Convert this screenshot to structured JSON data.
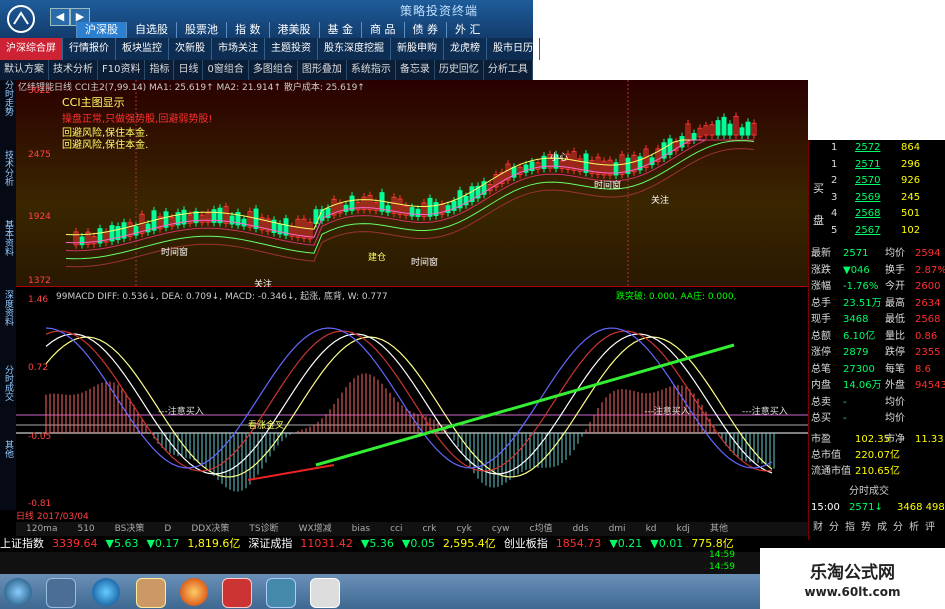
{
  "window": {
    "title": "策略投资终端",
    "title_menu": [
      "沪深股",
      "自选股",
      "股票池",
      "指 数",
      "港美股",
      "基 金",
      "商 品",
      "债 券",
      "外 汇"
    ],
    "title_menu_active": "沪深股"
  },
  "nav_tabs": [
    "沪深综合屏",
    "行情报价",
    "板块监控",
    "次新股",
    "市场关注",
    "主题投资",
    "股东深度挖掘",
    "新股申购",
    "龙虎榜",
    "股市日历"
  ],
  "toolbar": [
    "默认方案",
    "技术分析",
    "F10资料",
    "指标",
    "日线",
    "0窗组合",
    "多图组合",
    "图形叠加",
    "系统指示",
    "备忘录",
    "历史回忆",
    "分析工具"
  ],
  "left_tabs": [
    "分时走势",
    "技术分析",
    "基本资料",
    "深度资料",
    "分时成交",
    "其他"
  ],
  "pane1": {
    "header": "亿纬锂能日线 CCI主2(7,99.14) MA1: 25.619↑ MA2: 21.914↑ 散户成本: 25.619↑",
    "cci_title": "CCI主图显示",
    "lines": [
      "操盘正常,只做强势股,回避弱势股!",
      "回避风险,保住本金.",
      "回避风险,保住本金."
    ],
    "y_labels": [
      "3022",
      "2475",
      "1924",
      "1372"
    ],
    "annotations": [
      "时间窗",
      "建仓",
      "关注",
      "时间窗",
      "时间窗",
      "关注",
      "小心"
    ]
  },
  "pane2": {
    "header": "99MACD DIFF: 0.536↓, DEA: 0.709↓, MACD: -0.346↓, 起涨, 底背, W: 0.777",
    "right_header": "跌突破: 0.000, AA庄: 0.000,",
    "y_labels": [
      "1.46",
      "0.72",
      "-0.05",
      "-0.81"
    ],
    "labels": [
      "---注意买入",
      "---注意买入",
      "---注意买入",
      "看涨金叉"
    ],
    "bottom_left": "日线 2017/03/04"
  },
  "index_bar": [
    "120ma",
    "510",
    "BS决策",
    "D",
    "DDX决策",
    "TS诊断",
    "WX增减",
    "bias",
    "cci",
    "crk",
    "cyk",
    "cyw",
    "c均值",
    "dds",
    "dmi",
    "kd",
    "kdj",
    "其他"
  ],
  "ticker": {
    "items": [
      {
        "name": "上证指数",
        "value": "3339.64",
        "chg": "▼5.63",
        "pct": "▼0.17",
        "amt": "1,819.6亿"
      },
      {
        "name": "深证成指",
        "value": "11031.42",
        "chg": "▼5.36",
        "pct": "▼0.05",
        "amt": "2,595.4亿"
      },
      {
        "name": "创业板指",
        "value": "1854.73",
        "chg": "▼0.21",
        "pct": "▼0.01",
        "amt": "775.8亿"
      }
    ]
  },
  "right_panel": {
    "order_book": [
      {
        "lvl": "1",
        "price": "2572",
        "vol": "864"
      },
      {
        "lvl": "1",
        "price": "2571",
        "vol": "296"
      },
      {
        "lvl": "2",
        "price": "2570",
        "vol": "926"
      },
      {
        "lvl": "3",
        "price": "2569",
        "vol": "245"
      },
      {
        "lvl": "4",
        "price": "2568",
        "vol": "501"
      },
      {
        "lvl": "5",
        "price": "2567",
        "vol": "102"
      }
    ],
    "side_buy": "买",
    "side_sell": "盘",
    "stats": [
      [
        "最新",
        "2571",
        "均价",
        "2594"
      ],
      [
        "涨跌",
        "▼046",
        "换手",
        "2.87%"
      ],
      [
        "涨幅",
        "-1.76%",
        "今开",
        "2600"
      ],
      [
        "总手",
        "23.51万",
        "最高",
        "2634"
      ],
      [
        "现手",
        "3468",
        "最低",
        "2568"
      ],
      [
        "总额",
        "6.10亿",
        "量比",
        "0.86"
      ],
      [
        "涨停",
        "2879",
        "跌停",
        "2355"
      ],
      [
        "总笔",
        "27300",
        "每笔",
        "8.6"
      ],
      [
        "内盘",
        "14.06万",
        "外盘",
        "94543"
      ],
      [
        "总卖",
        "-",
        "均价",
        ""
      ],
      [
        "总买",
        "-",
        "均价",
        ""
      ]
    ],
    "market": [
      [
        "市盈",
        "102.35",
        "市净",
        "11.33"
      ],
      [
        "总市值",
        "220.07亿",
        "",
        " "
      ],
      [
        "流通市值",
        "210.65亿",
        "",
        ""
      ]
    ],
    "tab": "分时成交",
    "trade": {
      "time": "15:00",
      "price": "2571↓",
      "vol": "3468 498"
    },
    "bottom_tabs": [
      "财",
      "分",
      "指",
      "势",
      "成",
      "分",
      "析",
      "评"
    ]
  },
  "tray": {
    "time1": "14:59",
    "time2": "14:59"
  },
  "watermark": {
    "line1": "乐淘公式网",
    "line2": "www.60lt.com"
  },
  "colors": {
    "accent": "#1e5c9a",
    "up": "#ff3030",
    "down": "#00ff66",
    "price": "#ffff00"
  }
}
